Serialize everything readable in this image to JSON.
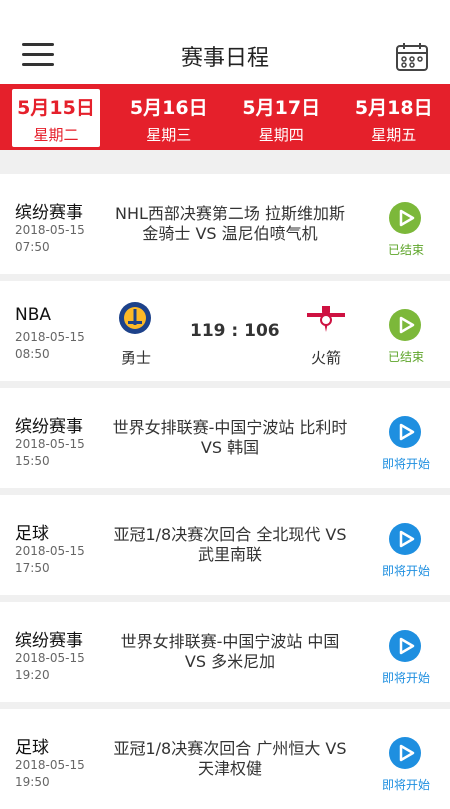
{
  "header": {
    "title": "赛事日程"
  },
  "dates": [
    {
      "date": "5月15日",
      "weekday": "星期二",
      "active": true
    },
    {
      "date": "5月16日",
      "weekday": "星期三"
    },
    {
      "date": "5月17日",
      "weekday": "星期四"
    },
    {
      "date": "5月18日",
      "weekday": "星期五"
    }
  ],
  "matches": [
    {
      "category": "缤纷赛事",
      "date": "2018-05-15",
      "time": "07:50",
      "desc": "NHL西部决赛第二场 拉斯维加斯金骑士 VS 温尼伯喷气机",
      "status": "已结束",
      "status_type": "ended"
    },
    {
      "category": "NBA",
      "date": "2018-05-15",
      "time": "08:50",
      "home": "勇士",
      "away": "火箭",
      "score": "119 : 106",
      "status": "已结束",
      "status_type": "ended",
      "home_logo_text": "GOLDEN STATE WARRIORS",
      "away_logo_text": "HOUSTON ROCKETS"
    },
    {
      "category": "缤纷赛事",
      "date": "2018-05-15",
      "time": "15:50",
      "desc": "世界女排联赛-中国宁波站 比利时 VS 韩国",
      "status": "即将开始",
      "status_type": "upcoming"
    },
    {
      "category": "足球",
      "date": "2018-05-15",
      "time": "17:50",
      "desc": "亚冠1/8决赛次回合 全北现代 VS 武里南联",
      "status": "即将开始",
      "status_type": "upcoming"
    },
    {
      "category": "缤纷赛事",
      "date": "2018-05-15",
      "time": "19:20",
      "desc": "世界女排联赛-中国宁波站 中国 VS 多米尼加",
      "status": "即将开始",
      "status_type": "upcoming"
    },
    {
      "category": "足球",
      "date": "2018-05-15",
      "time": "19:50",
      "desc": "亚冠1/8决赛次回合 广州恒大 VS 天津权健",
      "status": "即将开始",
      "status_type": "upcoming"
    }
  ],
  "colors": {
    "brand": "#e5202b",
    "ended": "#7cb83a",
    "upcoming": "#1e8fe0"
  }
}
